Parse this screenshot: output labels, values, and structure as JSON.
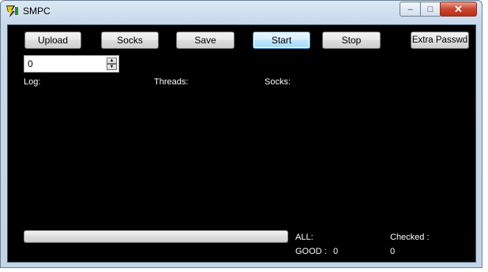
{
  "window": {
    "title": "SMPC"
  },
  "title_controls": {
    "minimize": "–",
    "maximize": "□",
    "close": "✕"
  },
  "toolbar": {
    "upload": "Upload",
    "socks": "Socks",
    "save": "Save",
    "start": "Start",
    "stop": "Stop",
    "extra": "Extra Passwd"
  },
  "numeric": {
    "value": "0"
  },
  "labels": {
    "log": "Log:",
    "threads": "Threads:",
    "socks": "Socks:",
    "all": "ALL:",
    "good": "GOOD :",
    "good_value": "0",
    "checked": "Checked :",
    "checked_value": "0"
  },
  "progress": {
    "fraction": 0
  },
  "icons": {
    "app": "app-logo-icon",
    "spin_up": "spin-up-icon",
    "spin_down": "spin-down-icon"
  }
}
